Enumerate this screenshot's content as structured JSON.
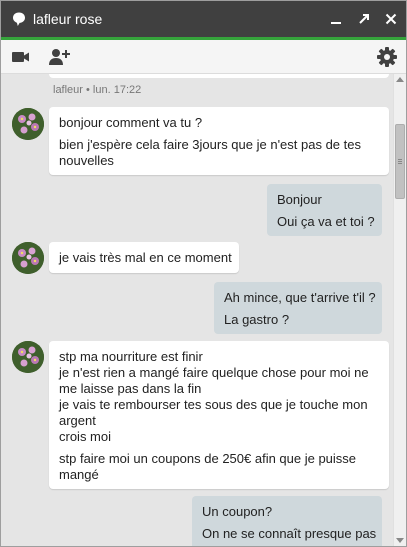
{
  "window": {
    "title": "lafleur rose",
    "accent_color": "#35a43b",
    "titlebar_color": "#404040",
    "icons": [
      "chat-bubble-icon",
      "minimize-icon",
      "popout-icon",
      "close-icon"
    ]
  },
  "toolbar": {
    "icons": [
      "video-call-icon",
      "add-person-icon",
      "settings-gear-icon"
    ]
  },
  "conversation": {
    "meta_line": "lafleur • lun. 17:22",
    "messages": [
      {
        "from": "contact",
        "lines": [
          "bonjour comment va tu ?",
          "bien j'espère cela faire 3jours que je n'est pas de tes nouvelles"
        ]
      },
      {
        "from": "me",
        "lines": [
          "Bonjour",
          "Oui ça va et toi ?"
        ]
      },
      {
        "from": "contact",
        "lines": [
          "je vais très mal en ce moment"
        ]
      },
      {
        "from": "me",
        "lines": [
          "Ah mince, que t'arrive t'il ?",
          "La gastro ?"
        ]
      },
      {
        "from": "contact",
        "lines": [
          "stp ma nourriture est finir",
          "je n'est rien a mangé faire quelque chose pour moi ne me laisse pas dans la fin",
          "je vais te rembourser tes sous des que je touche mon argent",
          "crois moi",
          "stp faire moi un coupons de 250€ afin que je puisse mangé"
        ]
      },
      {
        "from": "me",
        "lines": [
          "Un coupon?",
          "On ne se connaît presque pas"
        ]
      }
    ]
  }
}
